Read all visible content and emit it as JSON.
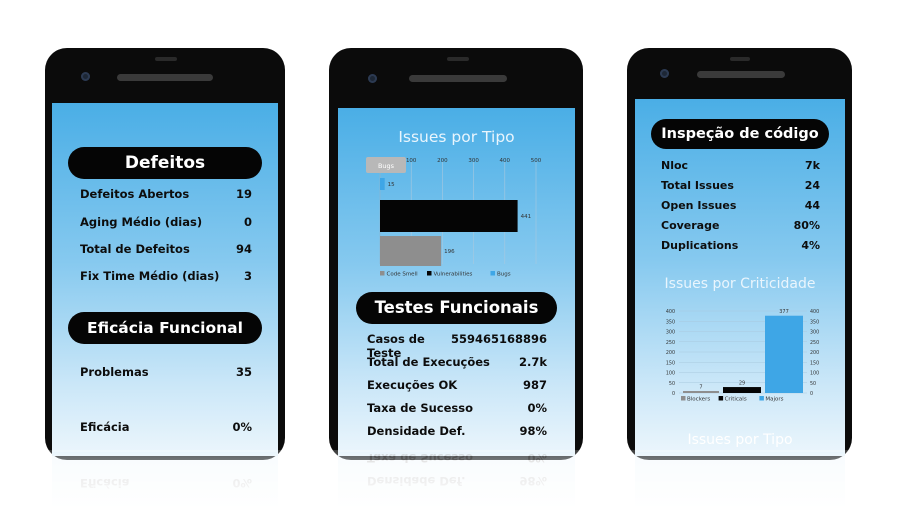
{
  "phone1": {
    "defeitos": {
      "title": "Defeitos",
      "rows": [
        {
          "label": "Defeitos Abertos",
          "value": "19"
        },
        {
          "label": "Aging Médio (dias)",
          "value": "0"
        },
        {
          "label": "Total de Defeitos",
          "value": "94"
        },
        {
          "label": "Fix Time Médio (dias)",
          "value": "3"
        }
      ]
    },
    "eficacia": {
      "title": "Eficácia Funcional",
      "problemas": {
        "label": "Problemas",
        "value": "35"
      },
      "eficacia": {
        "label": "Eficácia",
        "value": "0%"
      }
    }
  },
  "phone2": {
    "issues_title": "Issues por Tipo",
    "tooltip": "Bugs",
    "testes": {
      "title": "Testes Funcionais",
      "rows": [
        {
          "label": "Casos de Teste",
          "value": "559465168896"
        },
        {
          "label": "Total de Execuções",
          "value": "2.7k"
        },
        {
          "label": "Execuções OK",
          "value": "987"
        },
        {
          "label": "Taxa de Sucesso",
          "value": "0%"
        },
        {
          "label": "Densidade Def.",
          "value": "98%"
        }
      ]
    }
  },
  "phone3": {
    "inspecao": {
      "title": "Inspeção de código",
      "rows": [
        {
          "label": "Nloc",
          "value": "7k"
        },
        {
          "label": "Total Issues",
          "value": "24"
        },
        {
          "label": "Open Issues",
          "value": "44"
        },
        {
          "label": "Coverage",
          "value": "80%"
        },
        {
          "label": "Duplications",
          "value": "4%"
        }
      ]
    },
    "criticidade_title": "Issues por Criticidade",
    "next_title": "Issues por Tipo"
  },
  "colors": {
    "screen_top": "#4aaee6",
    "bars_blue": "#3ea6e6",
    "code_smell": "#8e8e8e",
    "vulnerabilities": "#050505"
  },
  "chart_data": [
    {
      "type": "bar",
      "orientation": "horizontal",
      "title": "Issues por Tipo",
      "x_ticks": [
        "100",
        "200",
        "300",
        "400",
        "500"
      ],
      "xlim": [
        0,
        500
      ],
      "categories": [
        "Bugs",
        "Vulnerabilities",
        "Code Smell"
      ],
      "values": [
        15,
        441,
        196
      ],
      "data_labels": [
        "15",
        "441",
        "196"
      ],
      "legend": [
        "Code Smell",
        "Vulnerabilities",
        "Bugs"
      ],
      "legend_position": "bottom"
    },
    {
      "type": "bar",
      "title": "Issues por Criticidade",
      "categories": [
        "Blockers",
        "Criticals",
        "Majors"
      ],
      "values": [
        7,
        29,
        377
      ],
      "data_labels": [
        "7",
        "29",
        "377"
      ],
      "y_ticks": [
        "400",
        "350",
        "300",
        "250",
        "200",
        "150",
        "100",
        "50",
        "0"
      ],
      "ylim": [
        0,
        400
      ],
      "legend": [
        "Blockers",
        "Criticals",
        "Majors"
      ],
      "legend_position": "bottom"
    }
  ]
}
